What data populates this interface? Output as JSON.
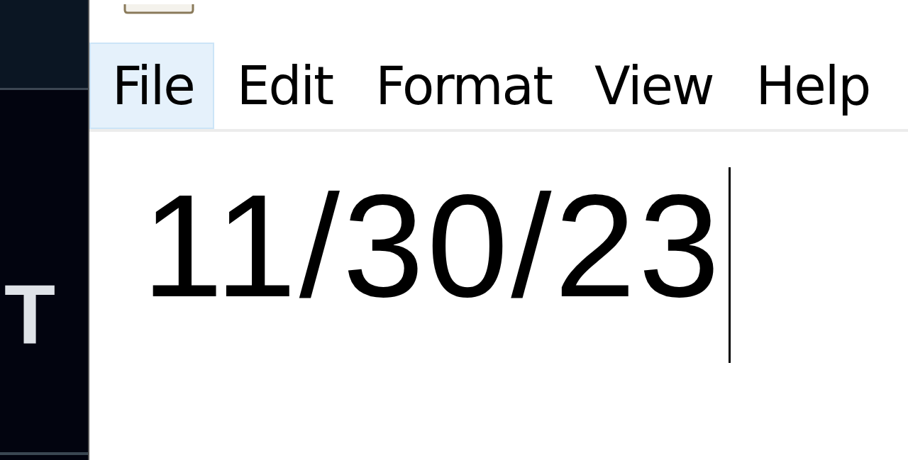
{
  "background": {
    "text": "T"
  },
  "menu": [
    {
      "label": "File",
      "selected": true
    },
    {
      "label": "Edit",
      "selected": false
    },
    {
      "label": "Format",
      "selected": false
    },
    {
      "label": "View",
      "selected": false
    },
    {
      "label": "Help",
      "selected": false
    }
  ],
  "editor": {
    "text": "11/30/23"
  }
}
